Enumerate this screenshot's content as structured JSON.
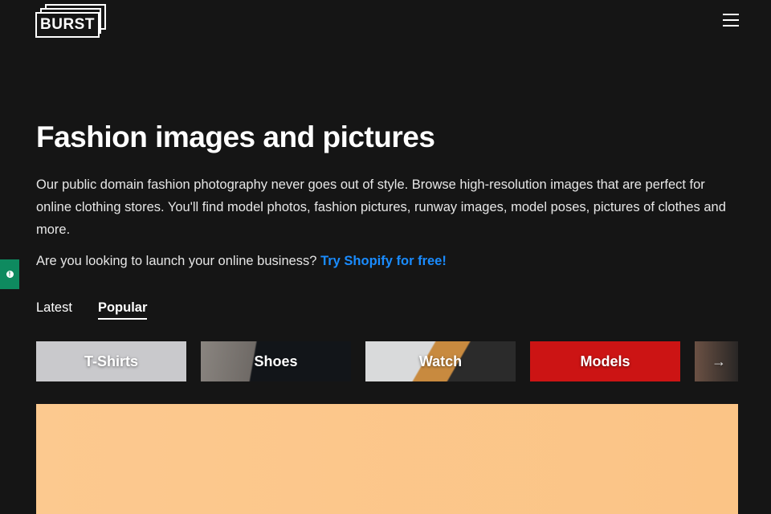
{
  "header": {
    "logo": "BURST",
    "menu_icon": "hamburger-icon"
  },
  "page": {
    "title": "Fashion images and pictures",
    "description": "Our public domain fashion photography never goes out of style. Browse high-resolution images that are perfect for online clothing stores. You'll find model photos, fashion pictures, runway images, model poses, pictures of clothes and more.",
    "cta_text": "Are you looking to launch your online business? ",
    "cta_link": "Try Shopify for free!"
  },
  "colors": {
    "background": "#151515",
    "link": "#1a8cff",
    "side_tab": "#0e8a5f"
  },
  "tabs": [
    {
      "label": "Latest",
      "active": false
    },
    {
      "label": "Popular",
      "active": true
    }
  ],
  "categories": [
    {
      "label": "T-Shirts"
    },
    {
      "label": "Shoes"
    },
    {
      "label": "Watch"
    },
    {
      "label": "Models"
    }
  ],
  "next_icon": "arrow-right-icon"
}
